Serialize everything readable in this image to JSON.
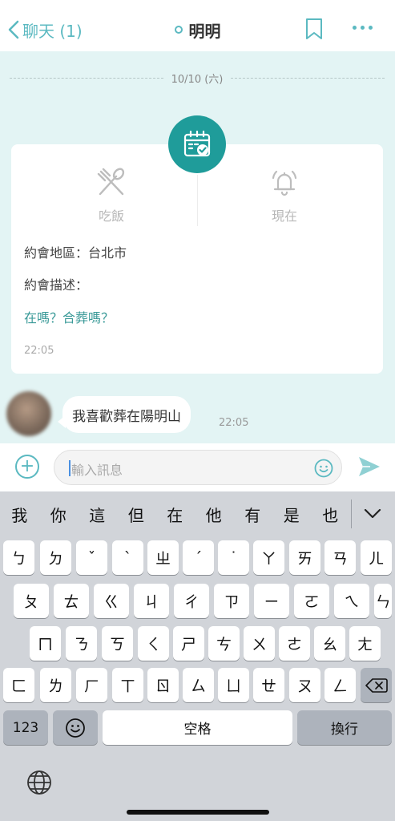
{
  "header": {
    "back_label": "聊天 (1)",
    "title": "明明"
  },
  "date_divider": "10/10 (六)",
  "card": {
    "option_meal": "吃飯",
    "option_time": "現在",
    "area_line": "約會地區：台北市",
    "desc_label": "約會描述：",
    "desc_text": "在嗎？合葬嗎？",
    "time": "22:05"
  },
  "message": {
    "text": "我喜歡葬在陽明山",
    "time": "22:05"
  },
  "input": {
    "placeholder": "輸入訊息"
  },
  "colors": {
    "accent": "#5bb9c1",
    "badge": "#1f9c9a",
    "chat_bg": "#e3f4f4"
  },
  "keyboard": {
    "suggestions": [
      "我",
      "你",
      "這",
      "但",
      "在",
      "他",
      "有",
      "是",
      "也"
    ],
    "row1": [
      "ㄅ",
      "ㄉ",
      "ˇ",
      "ˋ",
      "ㄓ",
      "ˊ",
      "˙",
      "ㄚ",
      "ㄞ",
      "ㄢ",
      "ㄦ"
    ],
    "row2": [
      "ㄆ",
      "ㄊ",
      "ㄍ",
      "ㄐ",
      "ㄔ",
      "ㄗ",
      "ㄧ",
      "ㄛ",
      "ㄟ",
      "ㄣ"
    ],
    "row3": [
      "ㄇ",
      "ㄋ",
      "ㄎ",
      "ㄑ",
      "ㄕ",
      "ㄘ",
      "ㄨ",
      "ㄜ",
      "ㄠ",
      "ㄤ"
    ],
    "row4": [
      "ㄈ",
      "ㄌ",
      "ㄏ",
      "ㄒ",
      "ㄖ",
      "ㄙ",
      "ㄩ",
      "ㄝ",
      "ㄡ",
      "ㄥ"
    ],
    "key_123": "123",
    "key_space": "空格",
    "key_return": "換行"
  }
}
